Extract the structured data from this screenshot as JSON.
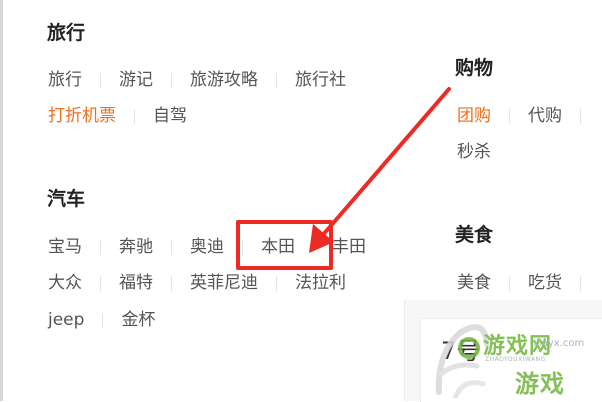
{
  "sections": {
    "travel": {
      "title": "旅行",
      "row1": [
        "旅行",
        "游记",
        "旅游攻略",
        "旅行社"
      ],
      "row2": [
        "打折机票",
        "自驾"
      ]
    },
    "cars": {
      "title": "汽车",
      "row1": [
        "宝马",
        "奔驰",
        "奥迪",
        "本田",
        "丰田"
      ],
      "row2": [
        "大众",
        "福特",
        "英菲尼迪",
        "法拉利"
      ],
      "row3": [
        "jeep",
        "金杯"
      ]
    },
    "shopping": {
      "title": "购物",
      "row1": [
        "团购",
        "代购"
      ],
      "row2": [
        "秒杀"
      ]
    },
    "food": {
      "title": "美食",
      "row1": [
        "美食",
        "吃货"
      ]
    }
  },
  "panel": {
    "number": "7号"
  },
  "annotation": {
    "highlighted_item": "本田",
    "color": "#ee2a24"
  },
  "watermark": {
    "brand": "游戏网",
    "domain": "xiayx.com",
    "pinyin": "ZHAOYOUXIWANG",
    "sub": "游戏"
  },
  "colors": {
    "link": "#555555",
    "hot_link": "#f26d1b",
    "title": "#222222"
  }
}
